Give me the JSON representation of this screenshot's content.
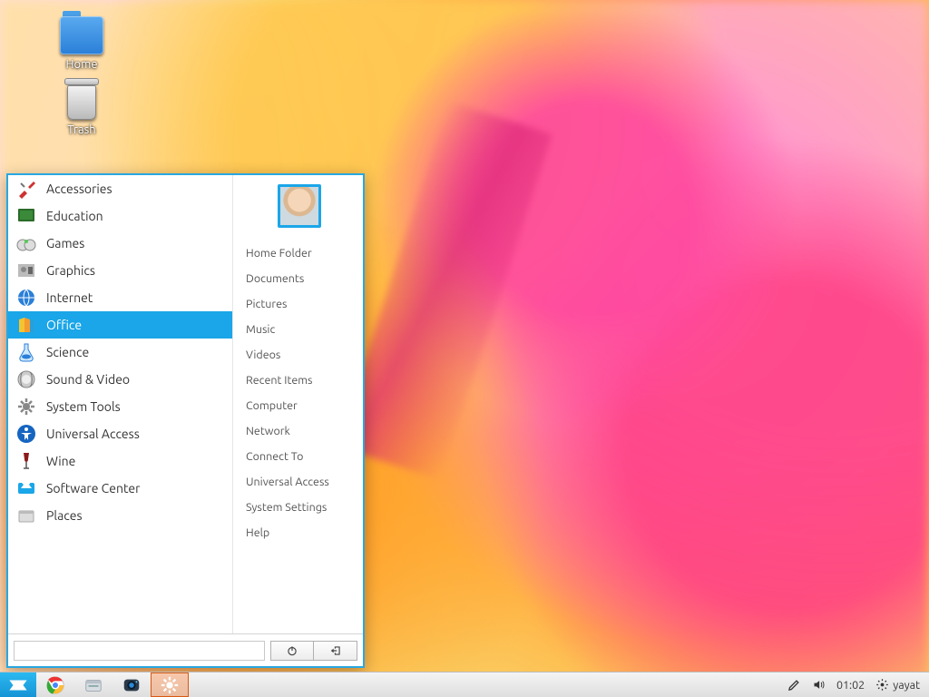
{
  "desktop": {
    "icons": [
      {
        "name": "home-folder",
        "label": "Home",
        "kind": "folder"
      },
      {
        "name": "trash",
        "label": "Trash",
        "kind": "trash"
      }
    ]
  },
  "menu": {
    "categories": [
      {
        "id": "accessories",
        "label": "Accessories",
        "icon": "accessories",
        "selected": false
      },
      {
        "id": "education",
        "label": "Education",
        "icon": "education",
        "selected": false
      },
      {
        "id": "games",
        "label": "Games",
        "icon": "games",
        "selected": false
      },
      {
        "id": "graphics",
        "label": "Graphics",
        "icon": "graphics",
        "selected": false
      },
      {
        "id": "internet",
        "label": "Internet",
        "icon": "internet",
        "selected": false
      },
      {
        "id": "office",
        "label": "Office",
        "icon": "office",
        "selected": true
      },
      {
        "id": "science",
        "label": "Science",
        "icon": "science",
        "selected": false
      },
      {
        "id": "sound-video",
        "label": "Sound & Video",
        "icon": "sound",
        "selected": false
      },
      {
        "id": "system-tools",
        "label": "System Tools",
        "icon": "systools",
        "selected": false
      },
      {
        "id": "universal-access",
        "label": "Universal Access",
        "icon": "ua",
        "selected": false
      },
      {
        "id": "wine",
        "label": "Wine",
        "icon": "wine",
        "selected": false
      },
      {
        "id": "software-center",
        "label": "Software Center",
        "icon": "softcenter",
        "selected": false
      },
      {
        "id": "places",
        "label": "Places",
        "icon": "places",
        "selected": false
      }
    ],
    "places": [
      {
        "id": "home-folder",
        "label": "Home Folder"
      },
      {
        "id": "documents",
        "label": "Documents"
      },
      {
        "id": "pictures",
        "label": "Pictures"
      },
      {
        "id": "music",
        "label": "Music"
      },
      {
        "id": "videos",
        "label": "Videos"
      },
      {
        "id": "recent",
        "label": "Recent Items"
      },
      {
        "id": "computer",
        "label": "Computer"
      },
      {
        "id": "network",
        "label": "Network"
      },
      {
        "id": "connect-to",
        "label": "Connect To"
      },
      {
        "id": "universal-access",
        "label": "Universal Access"
      },
      {
        "id": "system-settings",
        "label": "System Settings"
      },
      {
        "id": "help",
        "label": "Help"
      }
    ],
    "search": {
      "value": "",
      "placeholder": ""
    },
    "power": {
      "shutdown_label": "Shutdown",
      "logout_label": "Logout"
    }
  },
  "panel": {
    "launchers": [
      {
        "id": "chrome",
        "name": "google-chrome",
        "active": false
      },
      {
        "id": "files",
        "name": "file-manager",
        "active": false
      },
      {
        "id": "camera",
        "name": "cheese-webcam",
        "active": false
      },
      {
        "id": "settings",
        "name": "system-settings",
        "active": true
      }
    ],
    "tray": {
      "time": "01:02",
      "user": "yayat"
    }
  }
}
